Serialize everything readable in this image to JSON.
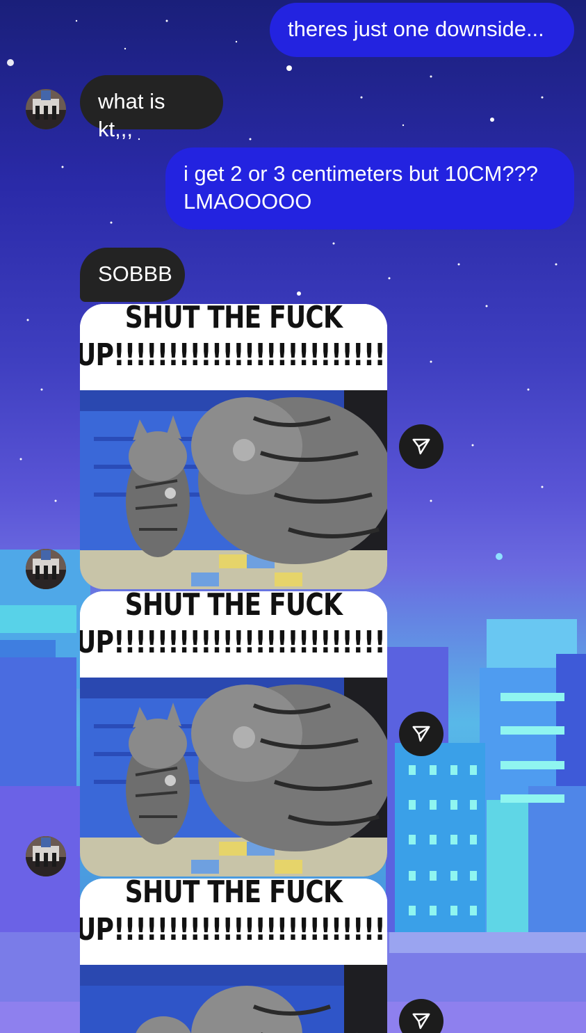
{
  "messages": [
    {
      "type": "outgoing",
      "text": "theres just one downside..."
    },
    {
      "type": "incoming",
      "text": "what is kt,,,"
    },
    {
      "type": "outgoing",
      "text": "i get 2 or 3 centimeters but 10CM??? LMAOOOOO"
    },
    {
      "type": "incoming",
      "text": "SOBBB"
    }
  ],
  "gifs": [
    {
      "line1": "SHUT THE FUCK",
      "line2": "UP!!!!!!!!!!!!!!!!!!!!!!!!!!!"
    },
    {
      "line1": "SHUT THE FUCK",
      "line2": "UP!!!!!!!!!!!!!!!!!!!!!!!!!!!"
    },
    {
      "line1": "SHUT THE FUCK",
      "line2": "UP!!!!!!!!!!!!!!!!!!!!!!!!!!!"
    }
  ],
  "icons": {
    "share": "send-paper-plane-icon",
    "avatar": "contact-avatar"
  },
  "colors": {
    "outgoing_bubble": "#2323e0",
    "incoming_bubble": "#232323",
    "share_button": "#1c1c1c"
  }
}
